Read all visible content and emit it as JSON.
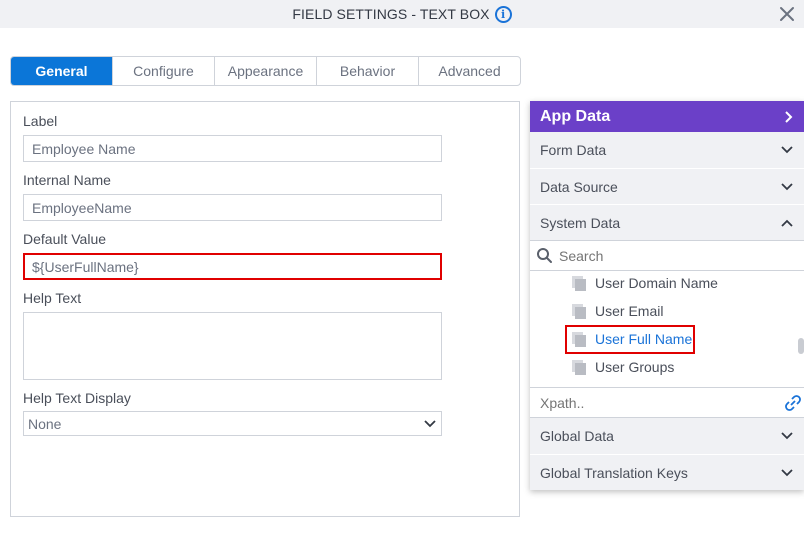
{
  "dialog": {
    "title": "FIELD SETTINGS - TEXT BOX",
    "info_icon": "info-icon",
    "close_icon": "close-icon"
  },
  "tabs": [
    {
      "label": "General",
      "active": true
    },
    {
      "label": "Configure",
      "active": false
    },
    {
      "label": "Appearance",
      "active": false
    },
    {
      "label": "Behavior",
      "active": false
    },
    {
      "label": "Advanced",
      "active": false
    }
  ],
  "form": {
    "label": {
      "label": "Label",
      "value": "Employee Name"
    },
    "internal_name": {
      "label": "Internal Name",
      "value": "EmployeeName"
    },
    "default_value": {
      "label": "Default Value",
      "value": "${UserFullName}"
    },
    "help_text": {
      "label": "Help Text",
      "value": ""
    },
    "help_text_display": {
      "label": "Help Text Display",
      "value": "None"
    }
  },
  "app_data": {
    "title": "App Data",
    "sections": [
      {
        "label": "Form Data",
        "expanded": false
      },
      {
        "label": "Data Source",
        "expanded": false
      },
      {
        "label": "System Data",
        "expanded": true
      }
    ],
    "search_placeholder": "Search",
    "items": [
      {
        "label": "User Domain Name",
        "selected": false
      },
      {
        "label": "User Email",
        "selected": false
      },
      {
        "label": "User Full Name",
        "selected": true
      },
      {
        "label": "User Groups",
        "selected": false
      }
    ],
    "xpath_placeholder": "Xpath..",
    "bottom_sections": [
      {
        "label": "Global Data",
        "expanded": false
      },
      {
        "label": "Global Translation Keys",
        "expanded": false
      }
    ]
  },
  "colors": {
    "accent": "#0b76d8",
    "app_data_header": "#6b40c8",
    "highlight": "#e00000",
    "selected_item": "#1a73d8"
  }
}
